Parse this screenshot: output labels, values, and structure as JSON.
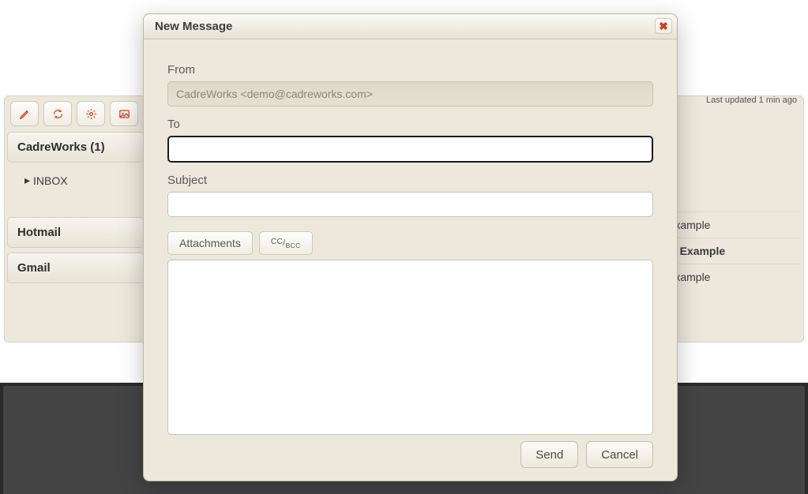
{
  "status": {
    "last_updated": "Last updated 1 min ago"
  },
  "sidebar": {
    "accounts": [
      {
        "name": "CadreWorks (1)",
        "folders": [
          {
            "label": "INBOX"
          }
        ]
      },
      {
        "name": "Hotmail"
      },
      {
        "name": "Gmail"
      }
    ]
  },
  "mail_list": {
    "rows": [
      {
        "subject_tail": "Example"
      },
      {
        "subject_tail": "je Example",
        "unread": true
      },
      {
        "subject_tail": "Example"
      }
    ]
  },
  "modal": {
    "title": "New Message",
    "from_label": "From",
    "from_value": "CadreWorks <demo@cadreworks.com>",
    "to_label": "To",
    "to_value": "",
    "subject_label": "Subject",
    "subject_value": "",
    "attachments_label": "Attachments",
    "ccbcc_html": "CC/BCC",
    "body_value": "",
    "send_label": "Send",
    "cancel_label": "Cancel"
  },
  "toolbar": {
    "icons": [
      "compose-icon",
      "refresh-icon",
      "gear-icon",
      "image-icon"
    ]
  },
  "colors": {
    "accent": "#d63a1a"
  }
}
